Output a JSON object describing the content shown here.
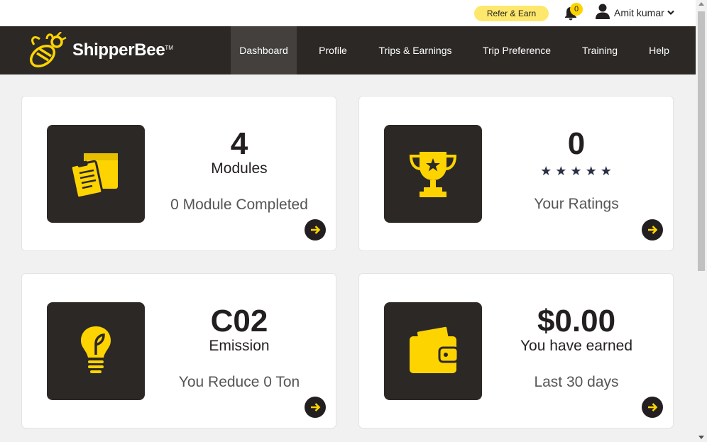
{
  "topbar": {
    "refer_label": "Refer & Earn",
    "notification_count": "0",
    "user_name": "Amit kumar"
  },
  "brand": {
    "name": "ShipperBee",
    "tm": "TM",
    "accent": "#fdd400",
    "dark": "#2c2826"
  },
  "nav": {
    "items": [
      {
        "label": "Dashboard",
        "active": true
      },
      {
        "label": "Profile"
      },
      {
        "label": "Trips & Earnings"
      },
      {
        "label": "Trip Preference"
      },
      {
        "label": "Training"
      },
      {
        "label": "Help"
      }
    ]
  },
  "cards": {
    "modules": {
      "value": "4",
      "label": "Modules",
      "sub": "0 Module Completed",
      "icon": "clipboard-box-icon"
    },
    "ratings": {
      "value": "0",
      "stars": "★★★★★",
      "sub": "Your Ratings",
      "icon": "trophy-icon"
    },
    "emission": {
      "value": "C02",
      "label": "Emission",
      "sub": "You Reduce 0 Ton",
      "icon": "eco-bulb-icon"
    },
    "earnings": {
      "value": "$0.00",
      "label": "You have earned",
      "sub": "Last 30 days",
      "icon": "wallet-icon"
    }
  }
}
